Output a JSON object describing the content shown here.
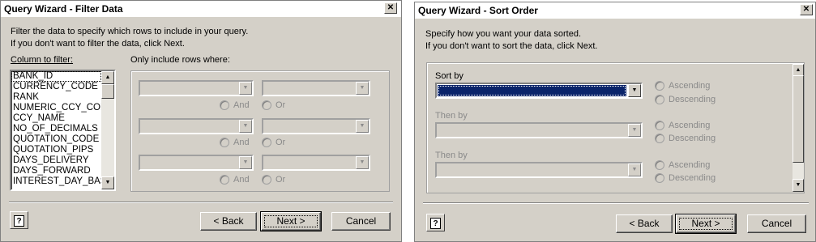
{
  "filter": {
    "title": "Query Wizard - Filter Data",
    "close_glyph": "✕",
    "intro_line1": "Filter the data to specify which rows to include in your query.",
    "intro_line2": "If you don't want to filter the data, click Next.",
    "column_label": "Column to filter:",
    "rows_label": "Only include rows where:",
    "columns": [
      "BANK_ID",
      "CURRENCY_CODE",
      "RANK",
      "NUMERIC_CCY_CODE",
      "CCY_NAME",
      "NO_OF_DECIMALS",
      "QUOTATION_CODE",
      "QUOTATION_PIPS",
      "DAYS_DELIVERY",
      "DAYS_FORWARD",
      "INTEREST_DAY_BAS"
    ],
    "selected_column": "BANK_ID",
    "and_label": "And",
    "or_label": "Or",
    "help_glyph": "?",
    "back_label": "< Back",
    "next_label": "Next >",
    "cancel_label": "Cancel"
  },
  "sort": {
    "title": "Query Wizard - Sort Order",
    "close_glyph": "✕",
    "intro_line1": "Specify how you want your data sorted.",
    "intro_line2": "If you don't want to sort the data, click Next.",
    "sort_by_label": "Sort by",
    "then_by_label": "Then by",
    "ascending_label": "Ascending",
    "descending_label": "Descending",
    "help_glyph": "?",
    "back_label": "< Back",
    "next_label": "Next >",
    "cancel_label": "Cancel"
  }
}
